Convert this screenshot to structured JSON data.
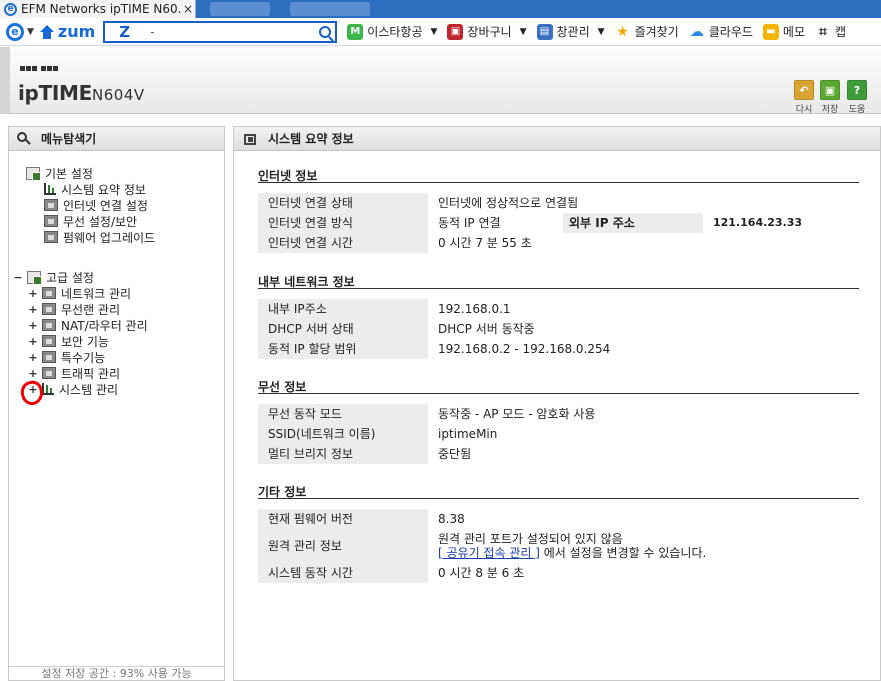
{
  "browser": {
    "tab_title": "EFM Networks ipTIME N60...",
    "tab_close": "×",
    "portal": "zum",
    "search_logo": "Z",
    "search_query": "-",
    "bookmarks": [
      {
        "label": "이스타항공",
        "icon": "M",
        "color": "#3cb54a",
        "caret": "▼"
      },
      {
        "label": "장바구니",
        "icon": "cart-icon",
        "color": "#c0262e",
        "caret": "▼"
      },
      {
        "label": "창관리",
        "icon": "window-icon",
        "color": "#3a6fc2",
        "caret": "▼"
      },
      {
        "label": "즐겨찾기",
        "icon": "star-icon",
        "color": "#f2a900",
        "caret": ""
      },
      {
        "label": "클라우드",
        "icon": "cloud-icon",
        "color": "#2a8be6",
        "caret": ""
      },
      {
        "label": "메모",
        "icon": "memo-icon",
        "color": "#f5b400",
        "caret": ""
      },
      {
        "label": "캡",
        "icon": "crop-icon",
        "color": "#333333",
        "caret": ""
      }
    ]
  },
  "header": {
    "brand": "ipTIME",
    "model": "N604V",
    "buttons": [
      {
        "label": "다시",
        "color": "#d9a431",
        "glyph": "↶"
      },
      {
        "label": "저장",
        "color": "#5aa832",
        "glyph": "▣"
      },
      {
        "label": "도움",
        "color": "#3f9a3a",
        "glyph": "?"
      }
    ]
  },
  "left": {
    "title": "메뉴탐색기",
    "basic": {
      "label": "기본 설정",
      "items": [
        "시스템 요약 정보",
        "인터넷 연결 설정",
        "무선 설정/보안",
        "펌웨어 업그레이드"
      ]
    },
    "advanced": {
      "label": "고급 설정",
      "toggle": "−",
      "items": [
        "네트워크 관리",
        "무선랜 관리",
        "NAT/라우터 관리",
        "보안 기능",
        "특수기능",
        "트래픽 관리",
        "시스템 관리"
      ]
    },
    "expand": "+",
    "storage": "설정 저장 공간 : 93% 사용 가능"
  },
  "main": {
    "title": "시스템 요약 정보",
    "internet": {
      "title": "인터넷 정보",
      "rows": [
        {
          "label": "인터넷 연결 상태",
          "value": "인터넷에 정상적으로 연결됨"
        },
        {
          "label": "인터넷 연결 방식",
          "value": "동적 IP 연결",
          "label2": "외부 IP 주소",
          "value2": "121.164.23.33"
        },
        {
          "label": "인터넷 연결 시간",
          "value": "0 시간 7 분 55 초"
        }
      ]
    },
    "lan": {
      "title": "내부 네트워크 정보",
      "rows": [
        {
          "label": "내부 IP주소",
          "value": "192.168.0.1"
        },
        {
          "label": "DHCP 서버 상태",
          "value": "DHCP 서버 동작중"
        },
        {
          "label": "동적 IP 할당 범위",
          "value": "192.168.0.2 -  192.168.0.254"
        }
      ]
    },
    "wireless": {
      "title": "무선 정보",
      "rows": [
        {
          "label": "무선 동작 모드",
          "value": "동작중 - AP 모드 - 암호화 사용"
        },
        {
          "label": "SSID(네트워크 이름)",
          "value": "iptimeMin"
        },
        {
          "label": "멀티 브리지 정보",
          "value": "중단됨"
        }
      ]
    },
    "etc": {
      "title": "기타 정보",
      "firmware_label": "현재 펌웨어 버전",
      "firmware_value": "8.38",
      "remote_label": "원격 관리 정보",
      "remote_line1": "원격 관리 포트가 설정되어 있지 않음",
      "remote_link": "[ 공유기 접속 관리 ]",
      "remote_line2": " 에서 설정을 변경할 수 있습니다.",
      "uptime_label": "시스템 동작 시간",
      "uptime_value": "0 시간 8 분 6 초"
    }
  }
}
